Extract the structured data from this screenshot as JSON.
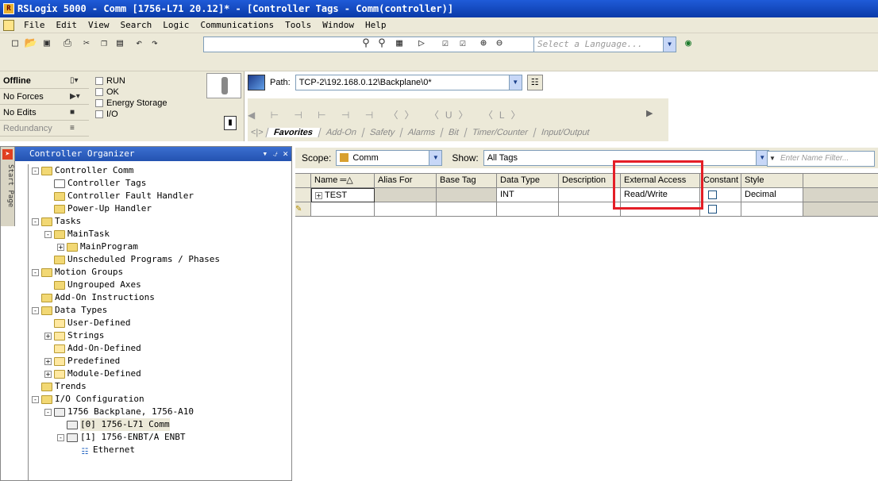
{
  "window": {
    "title": "RSLogix 5000 - Comm [1756-L71 20.12]* - [Controller Tags - Comm(controller)]"
  },
  "menu": {
    "items": [
      "File",
      "Edit",
      "View",
      "Search",
      "Logic",
      "Communications",
      "Tools",
      "Window",
      "Help"
    ]
  },
  "toolbar": {
    "language_placeholder": "Select a Language..."
  },
  "status": {
    "mode": "Offline",
    "forces": "No Forces",
    "edits": "No Edits",
    "redundancy": "Redundancy",
    "indicators": [
      "RUN",
      "OK",
      "Energy Storage",
      "I/O"
    ]
  },
  "path": {
    "label": "Path:",
    "value": "TCP-2\\192.168.0.12\\Backplane\\0*"
  },
  "instructions": {
    "tabs": [
      "Favorites",
      "Add-On",
      "Safety",
      "Alarms",
      "Bit",
      "Timer/Counter",
      "Input/Output"
    ]
  },
  "organizer": {
    "title": "Controller Organizer",
    "start_page": "Start Page",
    "tree": [
      {
        "label": "Controller Comm",
        "depth": 0,
        "toggle": "-",
        "icon": "folder"
      },
      {
        "label": "Controller Tags",
        "depth": 1,
        "toggle": "",
        "icon": "tag"
      },
      {
        "label": "Controller Fault Handler",
        "depth": 1,
        "toggle": "",
        "icon": "folder"
      },
      {
        "label": "Power-Up Handler",
        "depth": 1,
        "toggle": "",
        "icon": "folder"
      },
      {
        "label": "Tasks",
        "depth": 0,
        "toggle": "-",
        "icon": "folder"
      },
      {
        "label": "MainTask",
        "depth": 1,
        "toggle": "-",
        "icon": "folder"
      },
      {
        "label": "MainProgram",
        "depth": 2,
        "toggle": "+",
        "icon": "folder"
      },
      {
        "label": "Unscheduled Programs / Phases",
        "depth": 1,
        "toggle": "",
        "icon": "folder"
      },
      {
        "label": "Motion Groups",
        "depth": 0,
        "toggle": "-",
        "icon": "folder"
      },
      {
        "label": "Ungrouped Axes",
        "depth": 1,
        "toggle": "",
        "icon": "folder"
      },
      {
        "label": "Add-On Instructions",
        "depth": 0,
        "toggle": "",
        "icon": "folder"
      },
      {
        "label": "Data Types",
        "depth": 0,
        "toggle": "-",
        "icon": "folder"
      },
      {
        "label": "User-Defined",
        "depth": 1,
        "toggle": "",
        "icon": "datatype"
      },
      {
        "label": "Strings",
        "depth": 1,
        "toggle": "+",
        "icon": "datatype"
      },
      {
        "label": "Add-On-Defined",
        "depth": 1,
        "toggle": "",
        "icon": "datatype"
      },
      {
        "label": "Predefined",
        "depth": 1,
        "toggle": "+",
        "icon": "datatype"
      },
      {
        "label": "Module-Defined",
        "depth": 1,
        "toggle": "+",
        "icon": "datatype"
      },
      {
        "label": "Trends",
        "depth": 0,
        "toggle": "",
        "icon": "folder"
      },
      {
        "label": "I/O Configuration",
        "depth": 0,
        "toggle": "-",
        "icon": "folder"
      },
      {
        "label": "1756 Backplane, 1756-A10",
        "depth": 1,
        "toggle": "-",
        "icon": "module"
      },
      {
        "label": "[0] 1756-L71 Comm",
        "depth": 2,
        "toggle": "",
        "icon": "module",
        "selected": true
      },
      {
        "label": "[1] 1756-ENBT/A ENBT",
        "depth": 2,
        "toggle": "-",
        "icon": "module"
      },
      {
        "label": "Ethernet",
        "depth": 3,
        "toggle": "",
        "icon": "ethernet"
      }
    ]
  },
  "tags_view": {
    "scope_label": "Scope:",
    "scope_value": "Comm",
    "show_label": "Show:",
    "show_value": "All Tags",
    "filter_placeholder": "Enter Name Filter...",
    "columns": [
      "Name",
      "Alias For",
      "Base Tag",
      "Data Type",
      "Description",
      "External Access",
      "Constant",
      "Style"
    ],
    "rows": [
      {
        "name": "TEST",
        "alias_for": "",
        "base_tag": "",
        "data_type": "INT",
        "description": "",
        "external_access": "Read/Write",
        "constant": false,
        "style": "Decimal"
      },
      {
        "name": "",
        "alias_for": "",
        "base_tag": "",
        "data_type": "",
        "description": "",
        "external_access": "",
        "constant": false,
        "style": ""
      }
    ]
  },
  "colors": {
    "titlebar": "#0a3aa8",
    "highlight": "#e41e26",
    "chrome": "#ece9d8"
  }
}
